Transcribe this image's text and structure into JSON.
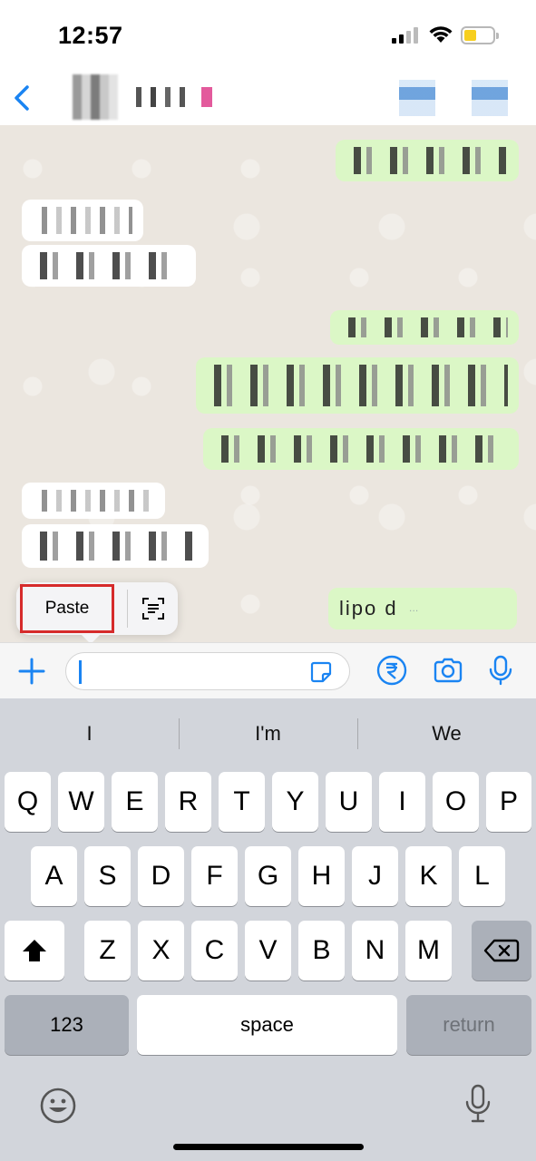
{
  "status_bar": {
    "time": "12:57"
  },
  "header": {
    "back_icon": "chevron-left-icon"
  },
  "chat": {
    "last_message": {
      "text": "lipo d",
      "meta": "…"
    }
  },
  "popup": {
    "paste_label": "Paste",
    "scan_icon": "scan-text-icon"
  },
  "input_bar": {
    "icons": [
      "plus-icon",
      "sticker-icon",
      "rupee-icon",
      "camera-icon",
      "microphone-icon"
    ],
    "accent": "#1a84f2"
  },
  "keyboard": {
    "suggestions": [
      "I",
      "I'm",
      "We"
    ],
    "row1": [
      "Q",
      "W",
      "E",
      "R",
      "T",
      "Y",
      "U",
      "I",
      "O",
      "P"
    ],
    "row2": [
      "A",
      "S",
      "D",
      "F",
      "G",
      "H",
      "J",
      "K",
      "L"
    ],
    "row3": [
      "Z",
      "X",
      "C",
      "V",
      "B",
      "N",
      "M"
    ],
    "numbers_label": "123",
    "space_label": "space",
    "return_label": "return"
  }
}
